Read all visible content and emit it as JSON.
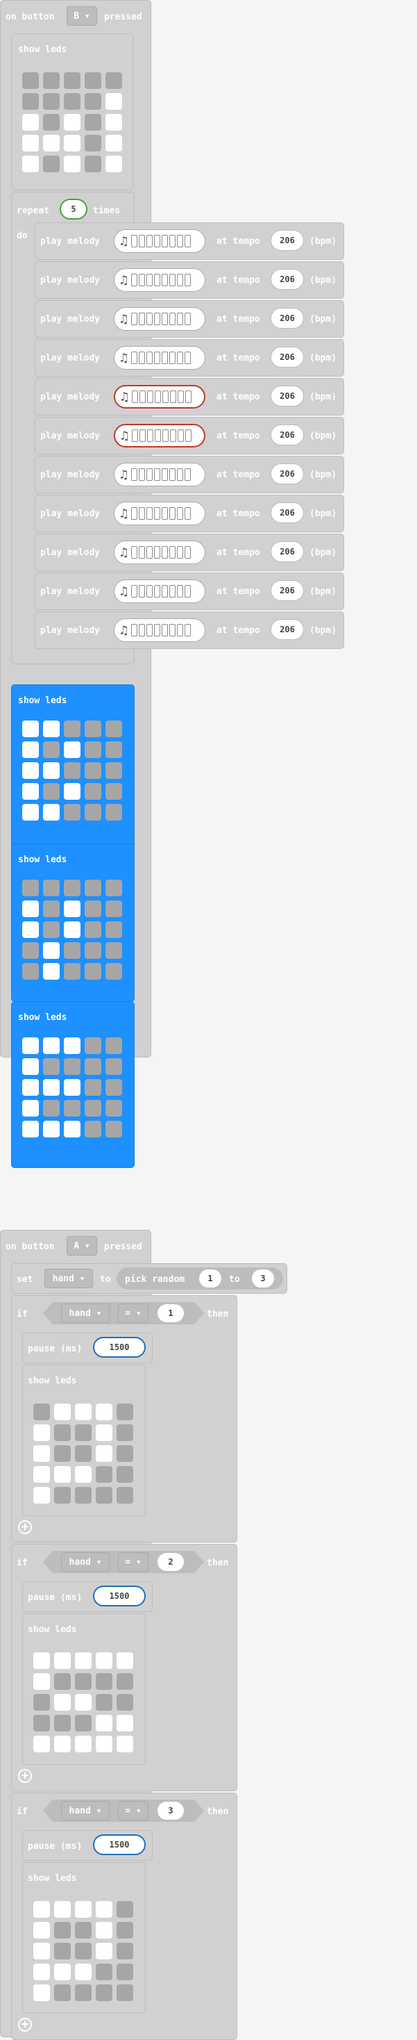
{
  "group1": {
    "event": {
      "prefix": "on button",
      "button": "B",
      "suffix": "pressed"
    },
    "show_leds_label": "show leds",
    "leds_top": [
      [
        0,
        0,
        0,
        0,
        0
      ],
      [
        0,
        0,
        0,
        0,
        1
      ],
      [
        1,
        0,
        1,
        0,
        1
      ],
      [
        1,
        1,
        1,
        0,
        1
      ],
      [
        1,
        0,
        1,
        0,
        1
      ]
    ],
    "repeat": {
      "label": "repeat",
      "count": "5",
      "times": "times",
      "do": "do"
    },
    "melodies": {
      "play_label": "play melody",
      "tempo_label": "at tempo",
      "tempo": "206",
      "bpm_label": "(bpm)",
      "red_rows": [
        4,
        5
      ]
    },
    "leds_blue1": [
      [
        1,
        1,
        0,
        0,
        0
      ],
      [
        1,
        0,
        1,
        0,
        0
      ],
      [
        1,
        1,
        0,
        0,
        0
      ],
      [
        1,
        0,
        1,
        0,
        0
      ],
      [
        1,
        1,
        0,
        0,
        0
      ]
    ],
    "leds_blue2": [
      [
        0,
        0,
        0,
        0,
        0
      ],
      [
        1,
        0,
        1,
        0,
        0
      ],
      [
        1,
        0,
        1,
        0,
        0
      ],
      [
        0,
        1,
        0,
        0,
        0
      ],
      [
        0,
        1,
        0,
        0,
        0
      ]
    ],
    "leds_blue3": [
      [
        1,
        1,
        1,
        0,
        0
      ],
      [
        1,
        0,
        0,
        0,
        0
      ],
      [
        1,
        1,
        1,
        0,
        0
      ],
      [
        1,
        0,
        0,
        0,
        0
      ],
      [
        1,
        1,
        1,
        0,
        0
      ]
    ]
  },
  "group2": {
    "event": {
      "prefix": "on button",
      "button": "A",
      "suffix": "pressed"
    },
    "set": {
      "label": "set",
      "var": "hand",
      "to": "to",
      "pick": "pick random",
      "from": "1",
      "to_word": "to",
      "max": "3"
    },
    "if_label": "if",
    "then_label": "then",
    "var": "hand",
    "op": "=",
    "pause_label": "pause (ms)",
    "pause": "1500",
    "show_leds_label": "show leds",
    "branches": [
      {
        "value": "1",
        "leds": [
          [
            0,
            1,
            1,
            1,
            0
          ],
          [
            1,
            0,
            0,
            1,
            0
          ],
          [
            1,
            0,
            0,
            1,
            0
          ],
          [
            1,
            1,
            1,
            0,
            0
          ],
          [
            1,
            0,
            0,
            0,
            0
          ]
        ]
      },
      {
        "value": "2",
        "leds": [
          [
            1,
            1,
            1,
            1,
            1
          ],
          [
            1,
            0,
            0,
            0,
            0
          ],
          [
            0,
            1,
            1,
            0,
            0
          ],
          [
            0,
            0,
            0,
            1,
            1
          ],
          [
            1,
            1,
            1,
            1,
            1
          ]
        ]
      },
      {
        "value": "3",
        "leds": [
          [
            1,
            1,
            1,
            1,
            0
          ],
          [
            1,
            0,
            0,
            1,
            0
          ],
          [
            1,
            0,
            0,
            1,
            0
          ],
          [
            1,
            1,
            1,
            0,
            0
          ],
          [
            1,
            0,
            0,
            0,
            0
          ]
        ]
      }
    ]
  }
}
